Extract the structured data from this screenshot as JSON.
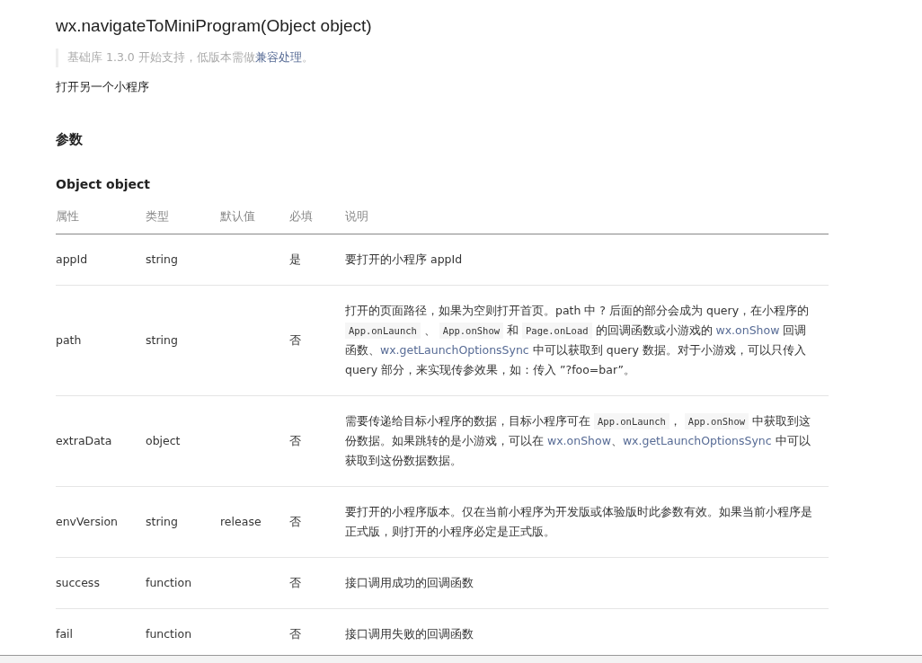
{
  "title": "wx.navigateToMiniProgram(Object object)",
  "note": [
    {
      "kind": "text",
      "text": "基础库 1.3.0 开始支持，低版本需做"
    },
    {
      "kind": "link",
      "text": "兼容处理"
    },
    {
      "kind": "text",
      "text": "。"
    }
  ],
  "summary": "打开另一个小程序",
  "section_heading": "参数",
  "subsection_heading": "Object object",
  "table": {
    "columns": [
      "属性",
      "类型",
      "默认值",
      "必填",
      "说明"
    ],
    "rows": [
      {
        "cells": [
          "appId",
          "string",
          "",
          "是"
        ],
        "description": [
          {
            "kind": "text",
            "text": "要打开的小程序 appId"
          }
        ]
      },
      {
        "cells": [
          "path",
          "string",
          "",
          "否"
        ],
        "description": [
          {
            "kind": "text",
            "text": "打开的页面路径，如果为空则打开首页。path 中 ? 后面的部分会成为 query，在小程序的 "
          },
          {
            "kind": "code",
            "text": "App.onLaunch"
          },
          {
            "kind": "text",
            "text": " 、 "
          },
          {
            "kind": "code",
            "text": "App.onShow"
          },
          {
            "kind": "text",
            "text": " 和 "
          },
          {
            "kind": "code",
            "text": "Page.onLoad"
          },
          {
            "kind": "text",
            "text": " 的回调函数或小游戏的 "
          },
          {
            "kind": "link",
            "text": "wx.onShow"
          },
          {
            "kind": "text",
            "text": " 回调函数、"
          },
          {
            "kind": "link",
            "text": "wx.getLaunchOptionsSync"
          },
          {
            "kind": "text",
            "text": " 中可以获取到 query 数据。对于小游戏，可以只传入 query 部分，来实现传参效果，如：传入 ”?foo=bar”。"
          }
        ]
      },
      {
        "cells": [
          "extraData",
          "object",
          "",
          "否"
        ],
        "description": [
          {
            "kind": "text",
            "text": "需要传递给目标小程序的数据，目标小程序可在 "
          },
          {
            "kind": "code",
            "text": "App.onLaunch"
          },
          {
            "kind": "text",
            "text": "， "
          },
          {
            "kind": "code",
            "text": "App.onShow"
          },
          {
            "kind": "text",
            "text": " 中获取到这份数据。如果跳转的是小游戏，可以在 "
          },
          {
            "kind": "link",
            "text": "wx.onShow"
          },
          {
            "kind": "text",
            "text": "、"
          },
          {
            "kind": "link",
            "text": "wx.getLaunchOptionsSync"
          },
          {
            "kind": "text",
            "text": " 中可以获取到这份数据数据。"
          }
        ]
      },
      {
        "cells": [
          "envVersion",
          "string",
          "release",
          "否"
        ],
        "description": [
          {
            "kind": "text",
            "text": "要打开的小程序版本。仅在当前小程序为开发版或体验版时此参数有效。如果当前小程序是正式版，则打开的小程序必定是正式版。"
          }
        ]
      },
      {
        "cells": [
          "success",
          "function",
          "",
          "否"
        ],
        "description": [
          {
            "kind": "text",
            "text": "接口调用成功的回调函数"
          }
        ]
      },
      {
        "cells": [
          "fail",
          "function",
          "",
          "否"
        ],
        "description": [
          {
            "kind": "text",
            "text": "接口调用失败的回调函数"
          }
        ]
      }
    ]
  }
}
